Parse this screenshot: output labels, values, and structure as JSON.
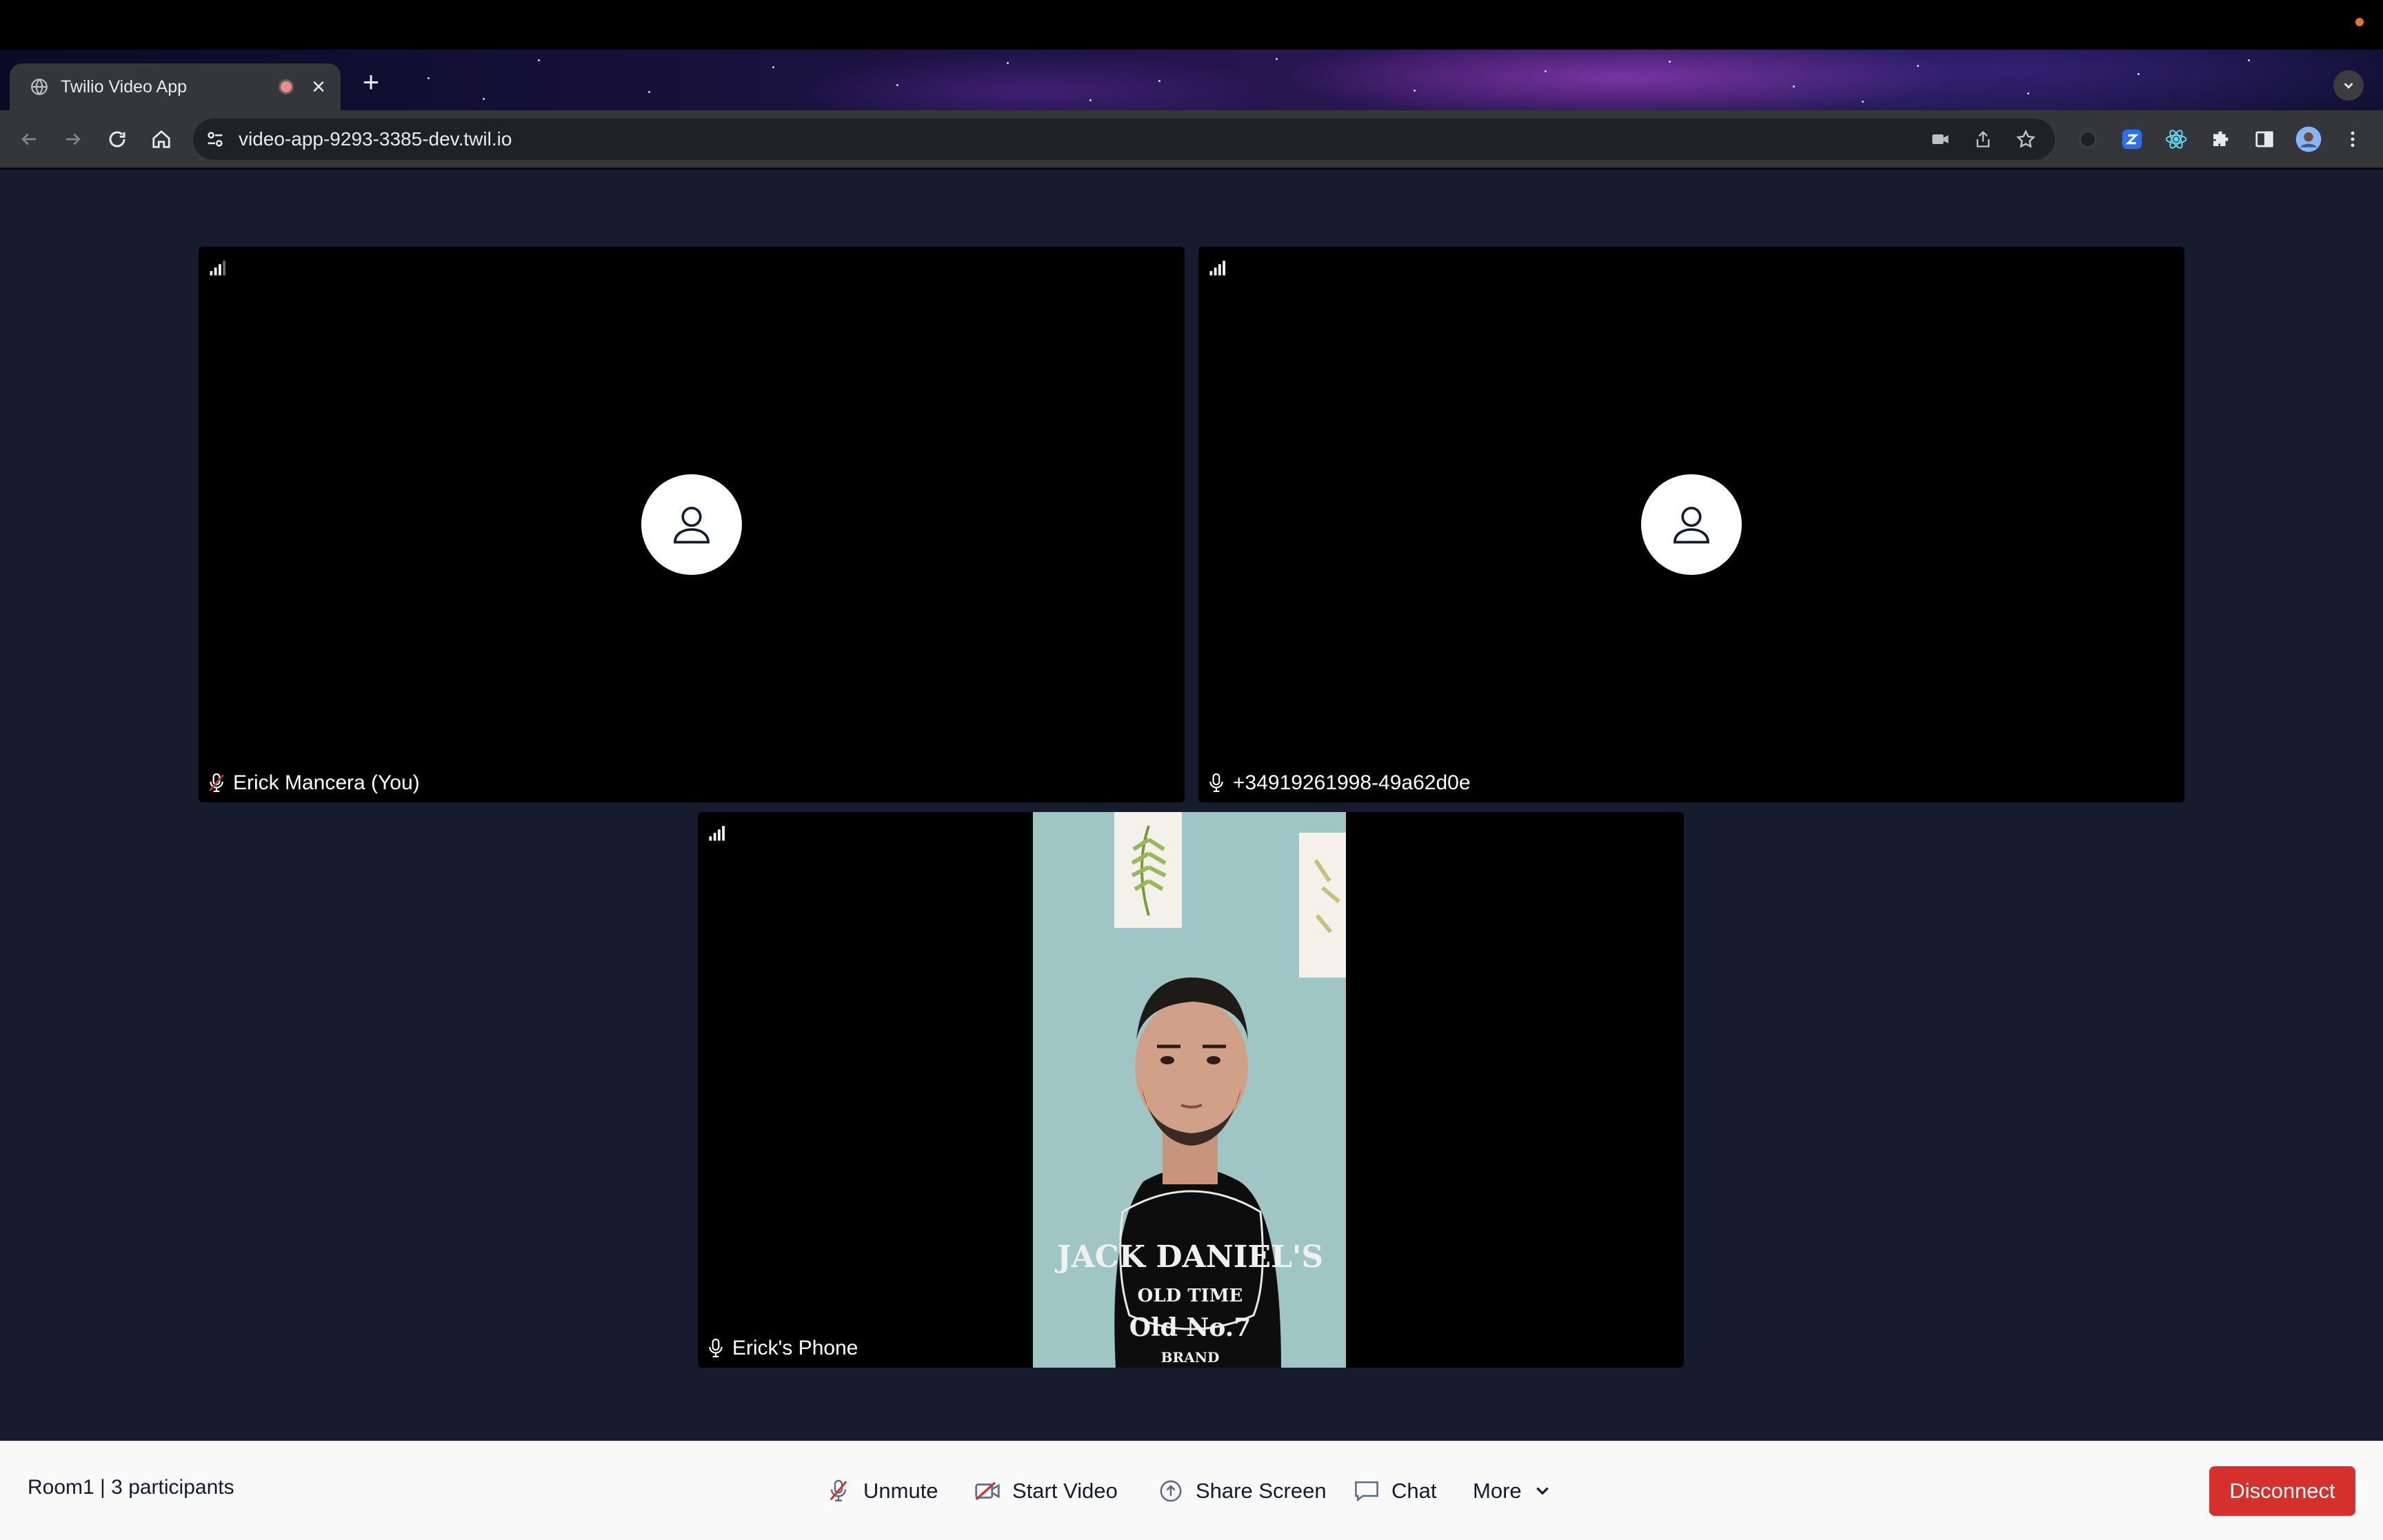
{
  "browser": {
    "tab_title": "Twilio Video App",
    "url": "video-app-9293-3385-dev.twil.io"
  },
  "participants": [
    {
      "name": "Erick Mancera (You)",
      "mic": "muted",
      "video": "off"
    },
    {
      "name": "+34919261998-49a62d0e",
      "mic": "on",
      "video": "off"
    },
    {
      "name": "Erick's Phone",
      "mic": "on",
      "video": "on"
    }
  ],
  "bottom_bar": {
    "room_info": "Room1 | 3 participants",
    "unmute_label": "Unmute",
    "start_video_label": "Start Video",
    "share_screen_label": "Share Screen",
    "chat_label": "Chat",
    "more_label": "More",
    "disconnect_label": "Disconnect"
  },
  "colors": {
    "app_background": "#161b2e",
    "disconnect_button": "#d6302c",
    "muted_icon": "#d6302c"
  },
  "icons": [
    "globe-icon",
    "recording-icon",
    "close-icon",
    "plus-icon",
    "back-icon",
    "forward-icon",
    "reload-icon",
    "home-icon",
    "site-info-icon",
    "camera-icon",
    "share-icon",
    "star-icon",
    "extension-icon",
    "side-panel-icon",
    "menu-icon",
    "signal-icon",
    "user-icon",
    "mic-icon",
    "mic-muted-icon",
    "video-off-icon",
    "share-screen-icon",
    "chat-icon",
    "chevron-down-icon"
  ]
}
